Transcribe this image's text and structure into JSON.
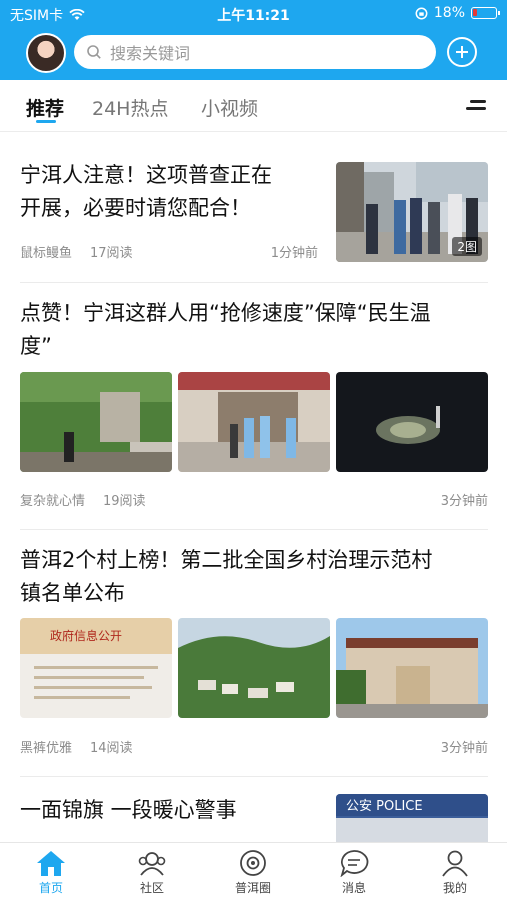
{
  "status_bar": {
    "carrier": "无SIM卡",
    "time": "上午11:21",
    "battery": "18%",
    "battery_level": 0.18
  },
  "header": {
    "search_placeholder": "搜索关键词"
  },
  "tabs": [
    {
      "label": "推荐",
      "active": true
    },
    {
      "label": "24H热点",
      "active": false
    },
    {
      "label": "小视频",
      "active": false
    }
  ],
  "articles": [
    {
      "title_lines": [
        "宁洱人注意！这项普查正在",
        "开展，必要时请您配合！"
      ],
      "source": "鼠标鳗鱼",
      "reads": "17阅读",
      "time": "1分钟前",
      "badge": "2图"
    },
    {
      "title_lines": [
        "点赞！宁洱这群人用“抢修速度”保障“民生温",
        "度”"
      ],
      "source": "复杂就心情",
      "reads": "19阅读",
      "time": "3分钟前"
    },
    {
      "title_lines": [
        "普洱2个村上榜！第二批全国乡村治理示范村",
        "镇名单公布"
      ],
      "source": "黑裤优雅",
      "reads": "14阅读",
      "time": "3分钟前",
      "image_text": "政府信息公开"
    },
    {
      "title_lines": [
        "一面锦旗 一段暖心警事"
      ],
      "image_text": "公安 POLICE"
    }
  ],
  "bottom_nav": [
    {
      "label": "首页",
      "icon": "home-icon",
      "active": true
    },
    {
      "label": "社区",
      "icon": "community-icon",
      "active": false
    },
    {
      "label": "普洱圈",
      "icon": "circle-icon",
      "active": false
    },
    {
      "label": "消息",
      "icon": "message-icon",
      "active": false
    },
    {
      "label": "我的",
      "icon": "profile-icon",
      "active": false
    }
  ],
  "colors": {
    "accent": "#1ea7ef",
    "battery_low": "#e53935"
  }
}
